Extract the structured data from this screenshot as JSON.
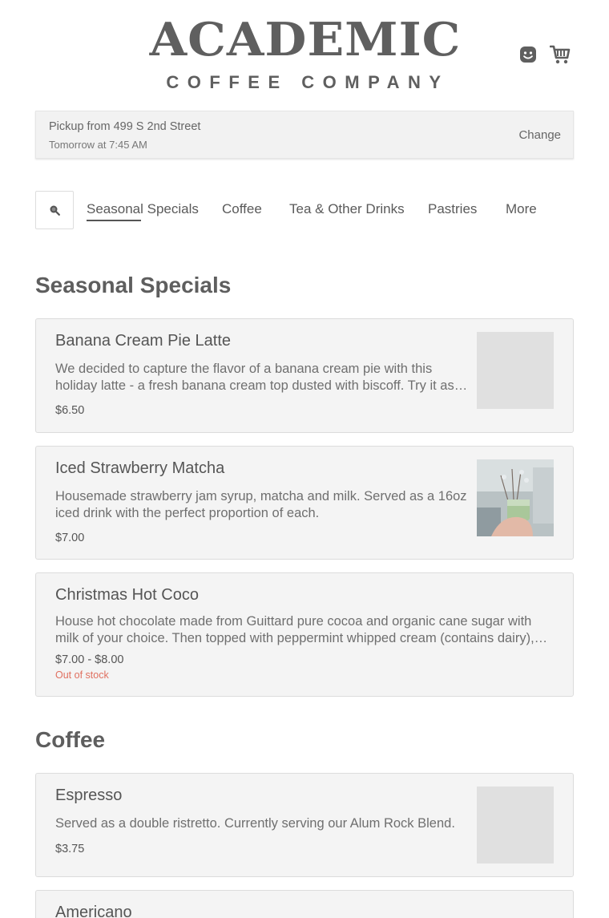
{
  "header": {
    "logo_main": "ACADEMIC",
    "logo_sub": "COFFEE COMPANY",
    "icons": [
      "account-icon",
      "cart-icon"
    ]
  },
  "pickup": {
    "location": "Pickup from 499 S 2nd Street",
    "time": "Tomorrow at 7:45 AM",
    "change_label": "Change"
  },
  "nav": {
    "items": [
      {
        "label": "Seasonal Specials",
        "active": true
      },
      {
        "label": "Coffee"
      },
      {
        "label": "Tea & Other Drinks"
      },
      {
        "label": "Pastries"
      },
      {
        "label": "More"
      }
    ]
  },
  "sections": [
    {
      "title": "Seasonal Specials",
      "items": [
        {
          "name": "Banana Cream Pie Latte",
          "description": "We decided to capture the flavor of a banana cream pie with this holiday latte - a fresh banana cream top dusted with biscoff. Try it as…",
          "price": "$6.50",
          "image": "placeholder"
        },
        {
          "name": "Iced Strawberry Matcha",
          "description": "Housemade strawberry jam syrup, matcha and milk. Served as a 16oz iced drink with the perfect proportion of each.",
          "price": "$7.00",
          "image": "photo"
        },
        {
          "name": "Christmas Hot Coco",
          "description": "House hot chocolate made from Guittard pure cocoa and organic cane sugar with milk of your choice. Then topped with peppermint whipped cream (contains dairy),…",
          "price": "$7.00 - $8.00",
          "stock": "Out of stock"
        }
      ]
    },
    {
      "title": "Coffee",
      "items": [
        {
          "name": "Espresso",
          "description": "Served as a double ristretto. Currently serving our Alum Rock Blend.",
          "price": "$3.75",
          "image": "placeholder"
        },
        {
          "name": "Americano"
        }
      ]
    }
  ],
  "colors": {
    "text": "#555555",
    "out_of_stock": "#e07060",
    "card_bg": "#f4f4f4",
    "placeholder": "#e0e0e0"
  }
}
